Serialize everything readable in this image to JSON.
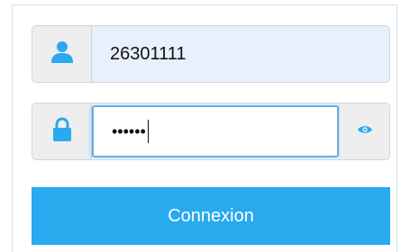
{
  "login": {
    "username_value": "26301111",
    "password_mask": "••••••",
    "submit_label": "Connexion"
  },
  "colors": {
    "accent": "#29a9ee",
    "icon": "#29a9ee",
    "autofill_bg": "#e8f0fe"
  },
  "icons": {
    "user": "user-icon",
    "lock": "lock-icon",
    "eye": "eye-icon"
  }
}
